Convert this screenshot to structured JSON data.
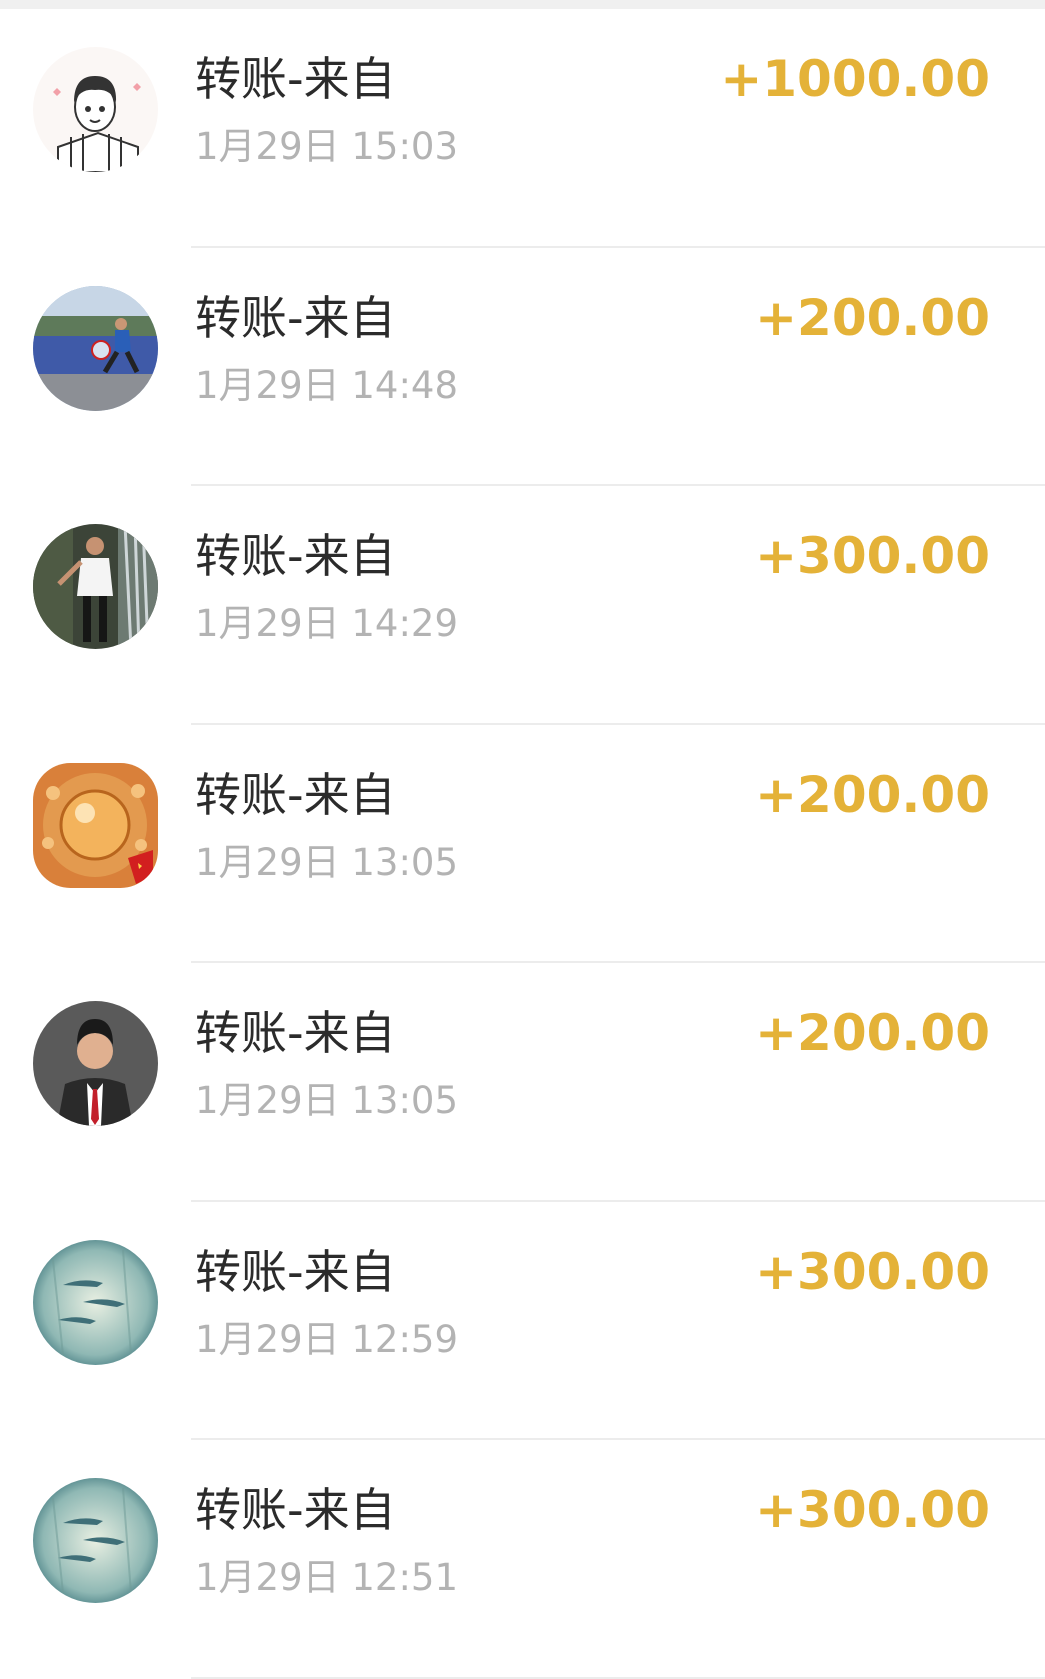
{
  "colors": {
    "amount": "#e4b238",
    "title": "#2b2b2b",
    "time": "#b3b3b3",
    "divider": "#ececec",
    "top_strip": "#f0f0f0"
  },
  "transactions": [
    {
      "title": "转账-来自",
      "time": "1月29日 15:03",
      "amount": "+1000.00",
      "avatar": "cartoon-boy-avatar"
    },
    {
      "title": "转账-来自",
      "time": "1月29日 14:48",
      "amount": "+200.00",
      "avatar": "runner-photo-avatar"
    },
    {
      "title": "转账-来自",
      "time": "1月29日 14:29",
      "amount": "+300.00",
      "avatar": "man-waterfall-photo-avatar"
    },
    {
      "title": "转账-来自",
      "time": "1月29日 13:05",
      "amount": "+200.00",
      "avatar": "golden-ornament-avatar"
    },
    {
      "title": "转账-来自",
      "time": "1月29日 13:05",
      "amount": "+200.00",
      "avatar": "man-in-suit-avatar"
    },
    {
      "title": "转账-来自",
      "time": "1月29日 12:59",
      "amount": "+300.00",
      "avatar": "teal-fish-avatar"
    },
    {
      "title": "转账-来自",
      "time": "1月29日 12:51",
      "amount": "+300.00",
      "avatar": "teal-fish-avatar"
    }
  ]
}
